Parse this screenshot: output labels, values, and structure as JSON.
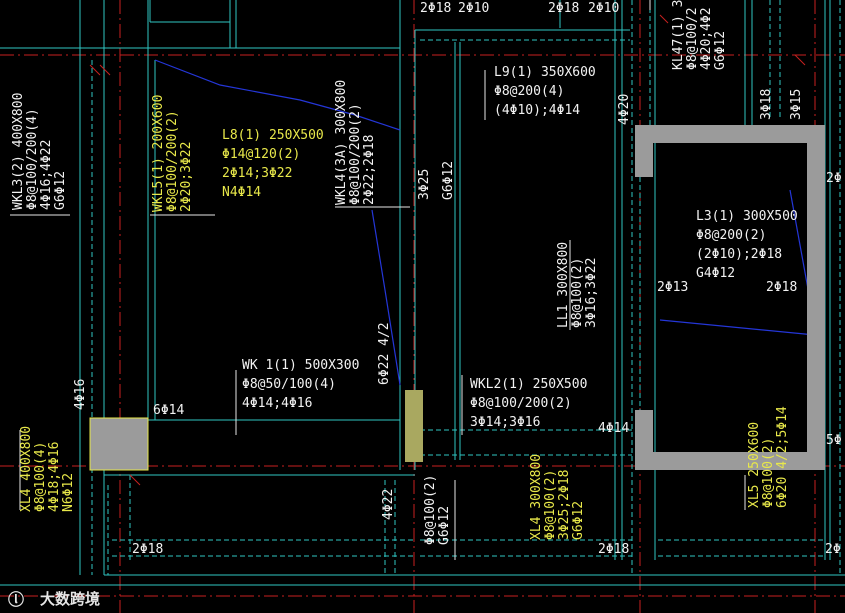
{
  "labels": {
    "top_a": "2Φ18",
    "top_a2": "2Φ10",
    "top_b": "2Φ18",
    "top_b2": "2Φ10",
    "wkl3": [
      "WKL3(2) 400X800",
      "Φ8@100/200(4)",
      "4Φ16;4Φ22",
      "G6Φ12"
    ],
    "wkl5": [
      "WKL5(1) 200X600",
      "Φ8@100/200(2)",
      "2Φ20;3Φ22"
    ],
    "l8": [
      "L8(1) 250X500",
      "Φ14@120(2)",
      "2Φ14;3Φ22",
      "N4Φ14"
    ],
    "wkl4": [
      "WKL4(3A) 300X800",
      "Φ8@100/200(2)",
      "2Φ22;2Φ18"
    ],
    "l9": [
      "L9(1) 350X600",
      "Φ8@200(4)",
      "(4Φ10);4Φ14"
    ],
    "kl47": [
      "KL47(1) 3",
      "Φ8@100/2",
      "4Φ20;4Φ2",
      "G6Φ12"
    ],
    "v_3b25": "3Φ25",
    "v_g6": "G6Φ12",
    "l3": [
      "L3(1) 300X500",
      "Φ8@200(2)",
      "(2Φ10);2Φ18",
      "G4Φ12"
    ],
    "ll1": [
      "LL1 300X800",
      "Φ8@100(2)",
      "3Φ16;3Φ22"
    ],
    "wk11": [
      "WK 1(1) 500X300",
      "Φ8@50/100(4)",
      "4Φ14;4Φ16"
    ],
    "wkl2": [
      "WKL2(1) 250X500",
      "Φ8@100/200(2)",
      "3Φ14;3Φ16"
    ],
    "xl4b": [
      "XL4 400X800",
      "Φ8@100(4)",
      "4Φ18;4Φ16",
      "N6Φ12"
    ],
    "xl4": [
      "XL4 300X800",
      "Φ8@100(2)",
      "3Φ25;2Φ18",
      "G6Φ12"
    ],
    "xl5": [
      "XL5 250X600",
      "Φ8@100(2)",
      "6Φ20 4/2;5Φ14"
    ],
    "v_mid": [
      "Φ8@100(2)",
      "G6Φ12"
    ],
    "v_mid2": "4Φ22",
    "v_6b22": "6Φ22 4/2",
    "a_2b18_l": "2Φ18",
    "a_2b18_m": "2Φ18",
    "a_2b18_r": "2Φ18",
    "a_2b_far": "2Φ",
    "a_6b14": "6Φ14",
    "a_4b14": "4Φ14",
    "a_5b": "5Φ",
    "a_2b13": "2Φ13",
    "a_3b18": "3Φ18",
    "a_3b15": "3Φ15",
    "a_4b20": "4Φ20",
    "a_4b16": "4Φ16",
    "a_2b_r": "2Φ",
    "watermark": "大数跨境"
  }
}
